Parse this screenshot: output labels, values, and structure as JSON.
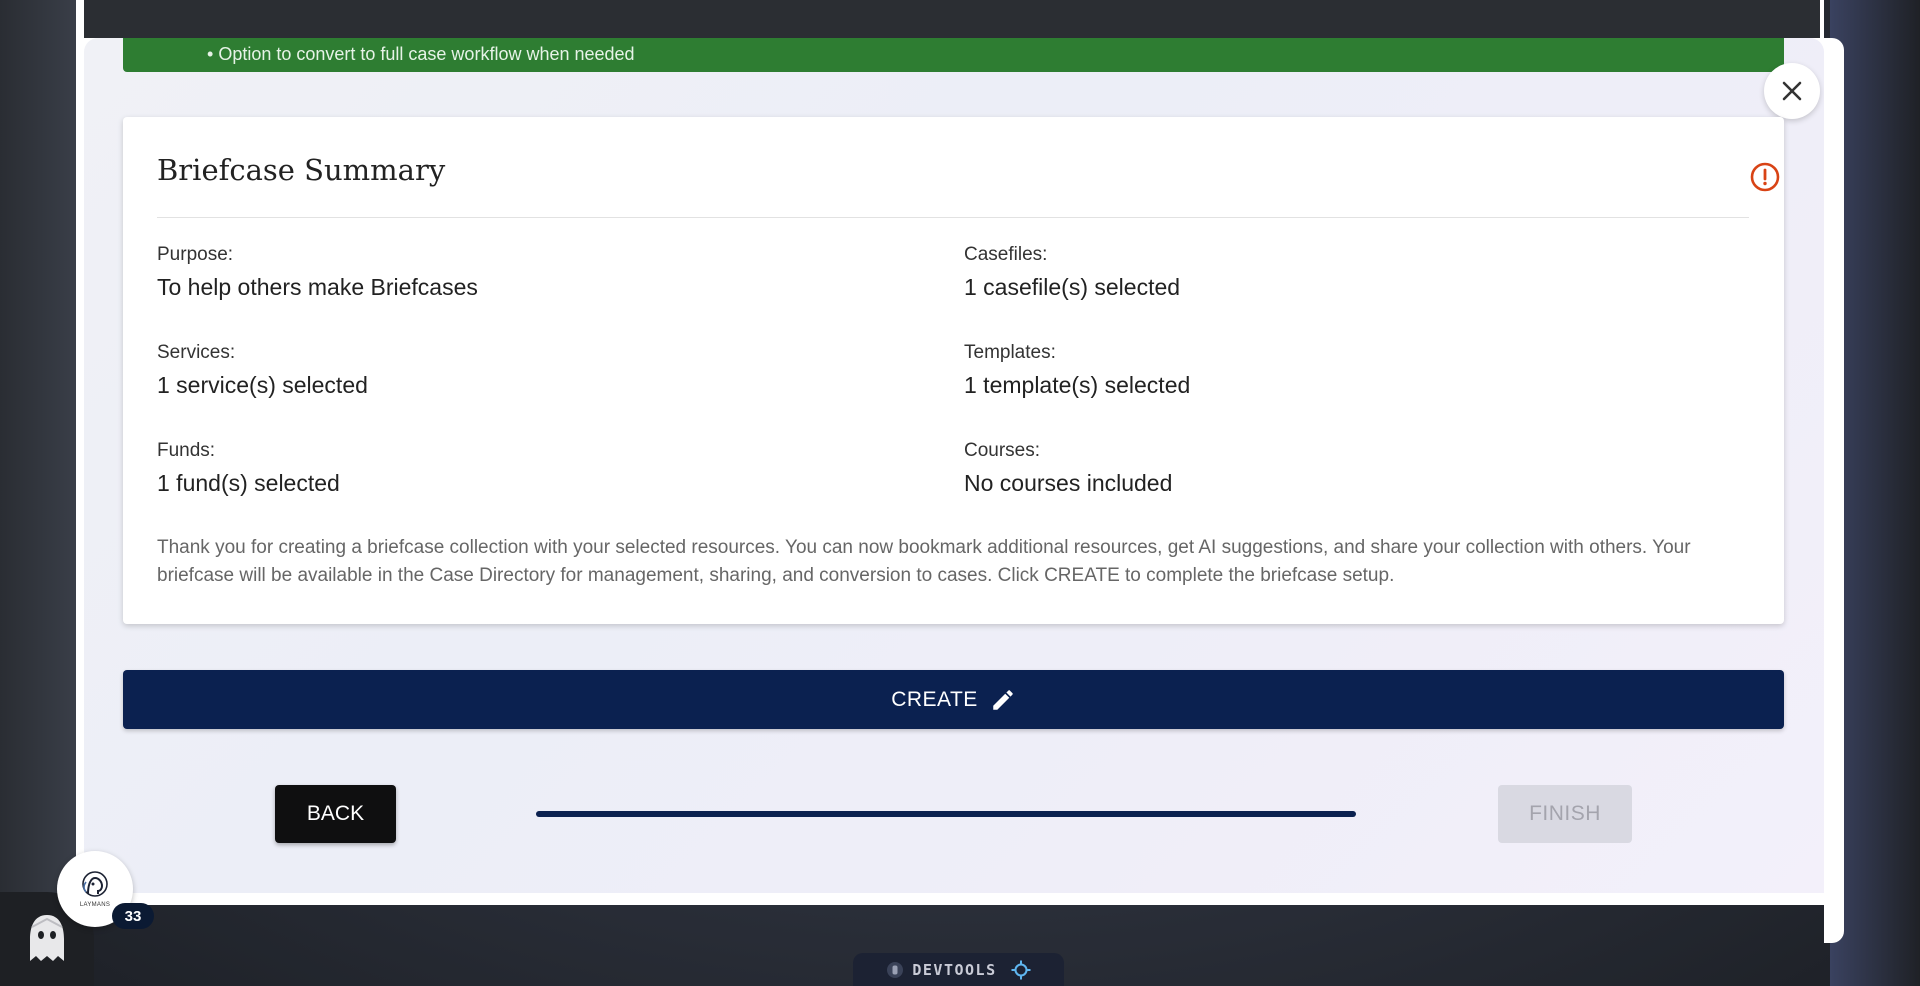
{
  "banner": {
    "bullet_text": "Option to convert to full case workflow when needed"
  },
  "summary": {
    "title": "Briefcase Summary",
    "fields": [
      {
        "label": "Purpose:",
        "value": "To help others make Briefcases"
      },
      {
        "label": "Casefiles:",
        "value": "1 casefile(s) selected"
      },
      {
        "label": "Services:",
        "value": "1 service(s) selected"
      },
      {
        "label": "Templates:",
        "value": "1 template(s) selected"
      },
      {
        "label": "Funds:",
        "value": "1 fund(s) selected"
      },
      {
        "label": "Courses:",
        "value": "No courses included"
      }
    ],
    "note": "Thank you for creating a briefcase collection with your selected resources. You can now bookmark additional resources, get AI suggestions, and share your collection with others. Your briefcase will be available in the Case Directory for management, sharing, and conversion to cases. Click CREATE to complete the briefcase setup."
  },
  "actions": {
    "create_label": "CREATE",
    "back_label": "BACK",
    "finish_label": "FINISH"
  },
  "progress": {
    "fraction": 1.0
  },
  "widget": {
    "caption": "LAYMANS",
    "badge_count": "33"
  },
  "devtools": {
    "label": "DEVTOOLS"
  },
  "colors": {
    "accent_navy": "#0b2150",
    "banner_green": "#2e7d32",
    "alert_red": "#d84315"
  },
  "icons": {
    "close": "close-icon",
    "alert": "alert-circle-icon",
    "create": "pencil-icon"
  }
}
